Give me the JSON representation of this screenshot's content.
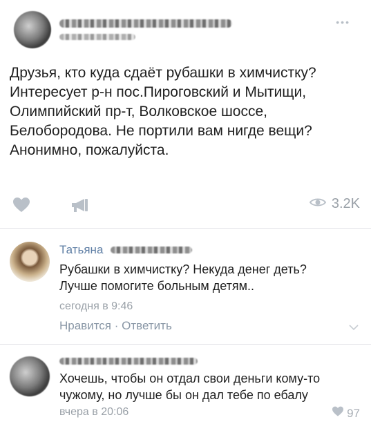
{
  "post": {
    "text_lines": [
      "Друзья, кто куда сдаёт рубашки в химчистку?",
      "Интересует р-н пос.Пироговский и Мытищи,",
      "Олимпийский пр-т, Волковское шоссе,",
      "Белобородова. Не портили вам нигде вещи?",
      "Анонимно, пожалуйста."
    ],
    "views": "3.2K"
  },
  "comments": [
    {
      "author": "Татьяна",
      "text_lines": [
        "Рубашки в химчистку? Некуда денег деть?",
        "Лучше помогите больным детям.."
      ],
      "time": "сегодня в 9:46",
      "like_label": "Нравится",
      "separator": "·",
      "reply_label": "Ответить"
    },
    {
      "text_lines": [
        "Хочешь, чтобы он отдал свои деньги кому-то",
        "чужому, но лучше бы он дал тебе по ебалу"
      ],
      "time": "вчера в 20:06",
      "likes": "97"
    }
  ],
  "icons": {
    "more": "more-icon",
    "like": "heart-icon",
    "share": "megaphone-icon",
    "views": "eye-icon",
    "expand": "chevron-down-icon"
  },
  "colors": {
    "link": "#5f7fa5",
    "muted": "#9aa1a8",
    "icon": "#b9c0c8"
  }
}
